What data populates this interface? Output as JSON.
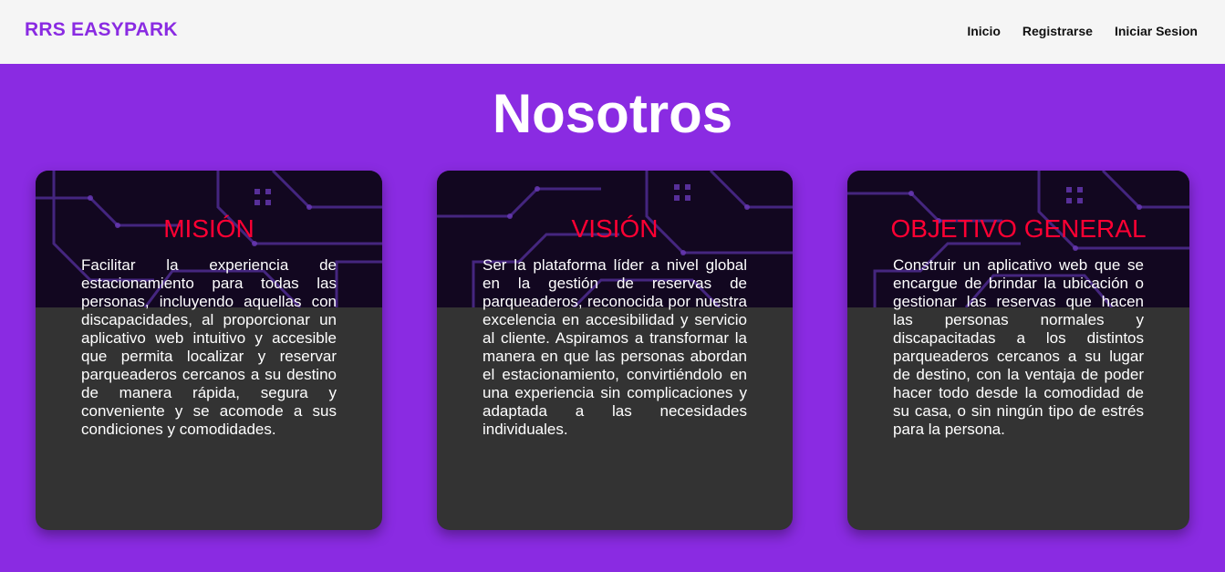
{
  "header": {
    "brand": "RRS EASYPARK",
    "nav": [
      {
        "label": "Inicio"
      },
      {
        "label": "Registrarse"
      },
      {
        "label": "Iniciar Sesion"
      }
    ]
  },
  "main": {
    "title": "Nosotros",
    "cards": [
      {
        "title": "MISIÓN",
        "text": "Facilitar la experiencia de estacionamiento para todas las personas, incluyendo aquellas con discapacidades, al proporcionar un aplicativo web intuitivo y accesible que permita localizar y reservar parqueaderos cercanos a su destino de manera rápida, segura y conveniente y se acomode a sus condiciones y comodidades."
      },
      {
        "title": "VISIÓN",
        "text": "Ser la plataforma líder a nivel global en la gestión de reservas de parqueaderos, reconocida por nuestra excelencia en accesibilidad y servicio al cliente. Aspiramos a transformar la manera en que las personas abordan el estacionamiento, convirtiéndolo en una experiencia sin complicaciones y adaptada a las necesidades individuales."
      },
      {
        "title": "OBJETIVO GENERAL",
        "text": "Construir un aplicativo web que se encargue de brindar la ubicación o gestionar las reservas que hacen las personas normales y discapacitadas a los distintos parqueaderos cercanos a su lugar de destino, con la ventaja de poder hacer todo desde la comodidad de su casa, o sin ningún tipo de estrés para la persona."
      }
    ]
  },
  "colors": {
    "page_bg": "#8a2be2",
    "brand": "#8a2be2",
    "card_bg": "#333333",
    "card_title": "#ff0033"
  }
}
